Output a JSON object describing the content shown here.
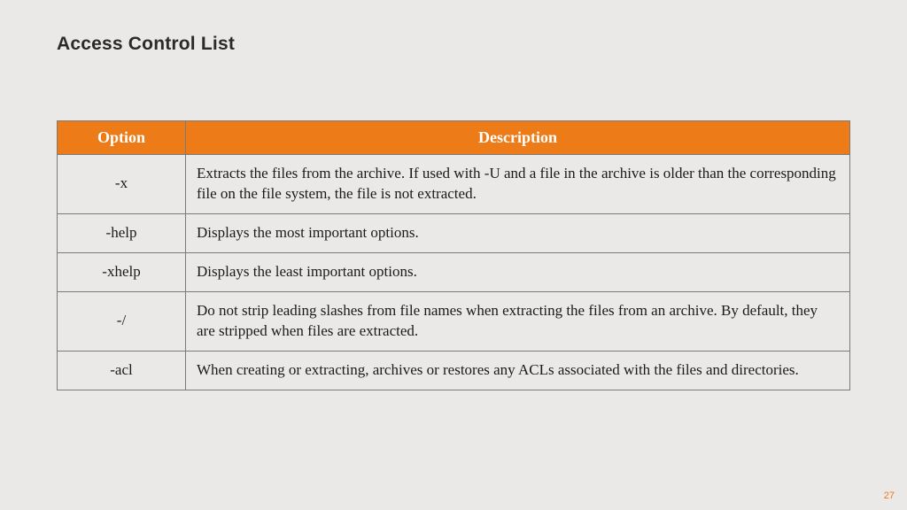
{
  "title": "Access Control List",
  "page_number": "27",
  "colors": {
    "accent": "#ec7b18",
    "background": "#ebe9e8"
  },
  "table": {
    "headers": {
      "option": "Option",
      "description": "Description"
    },
    "rows": [
      {
        "option": "-x",
        "description": "Extracts the files from the archive. If used with -U and a file in the archive is older than the corresponding file on the file system, the file is not extracted."
      },
      {
        "option": "-help",
        "description": "Displays the most important options."
      },
      {
        "option": "-xhelp",
        "description": "Displays the least important options."
      },
      {
        "option": "-/",
        "description": "Do not strip leading slashes from file names when extracting the files from an archive. By default, they are stripped when files are extracted."
      },
      {
        "option": "-acl",
        "description": "When creating or extracting, archives or restores any ACLs associated with the files and directories."
      }
    ]
  }
}
